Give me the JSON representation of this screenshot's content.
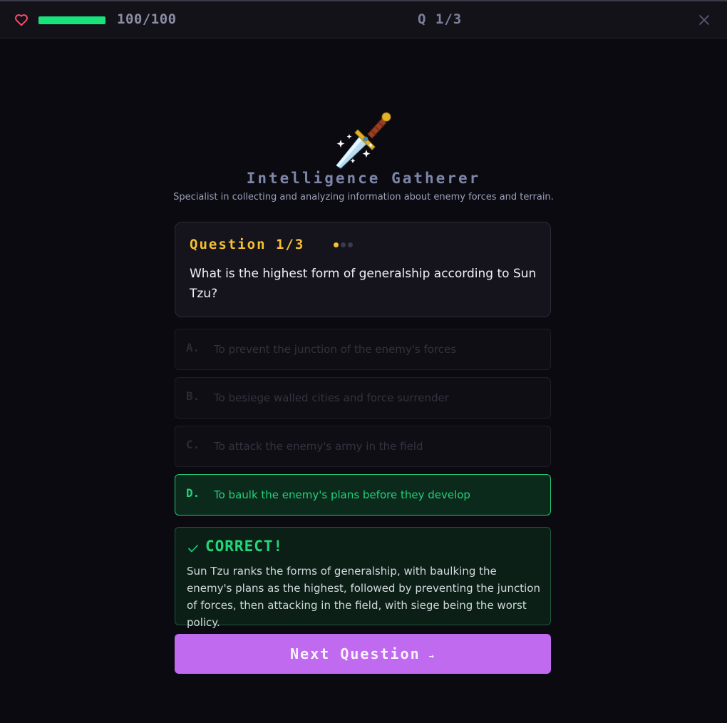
{
  "header": {
    "hp_text": "100/100",
    "hp_fraction": 1.0,
    "question_counter": "Q 1/3"
  },
  "role": {
    "icon": "dagger-icon",
    "title": "Intelligence Gatherer",
    "subtitle": "Specialist in collecting and analyzing information about enemy forces and terrain."
  },
  "question": {
    "label": "Question 1/3",
    "current": 1,
    "total": 3,
    "text": "What is the highest form of generalship according to Sun Tzu?"
  },
  "options": [
    {
      "letter": "A.",
      "text": "To prevent the junction of the enemy's forces",
      "state": "disabled"
    },
    {
      "letter": "B.",
      "text": "To besiege walled cities and force surrender",
      "state": "disabled"
    },
    {
      "letter": "C.",
      "text": "To attack the enemy's army in the field",
      "state": "disabled"
    },
    {
      "letter": "D.",
      "text": "To baulk the enemy's plans before they develop",
      "state": "correct"
    }
  ],
  "feedback": {
    "title": "CORRECT!",
    "text": "Sun Tzu ranks the forms of generalship, with baulking the enemy's plans as the highest, followed by preventing the junction of forces, then attacking in the field, with siege being the worst policy."
  },
  "next_button": {
    "label": "Next Question",
    "arrow": "→"
  },
  "colors": {
    "hp": "#19e27b",
    "accent_yellow": "#f5c033",
    "correct_green": "#20d27b",
    "button_purple": "#c06af0"
  }
}
